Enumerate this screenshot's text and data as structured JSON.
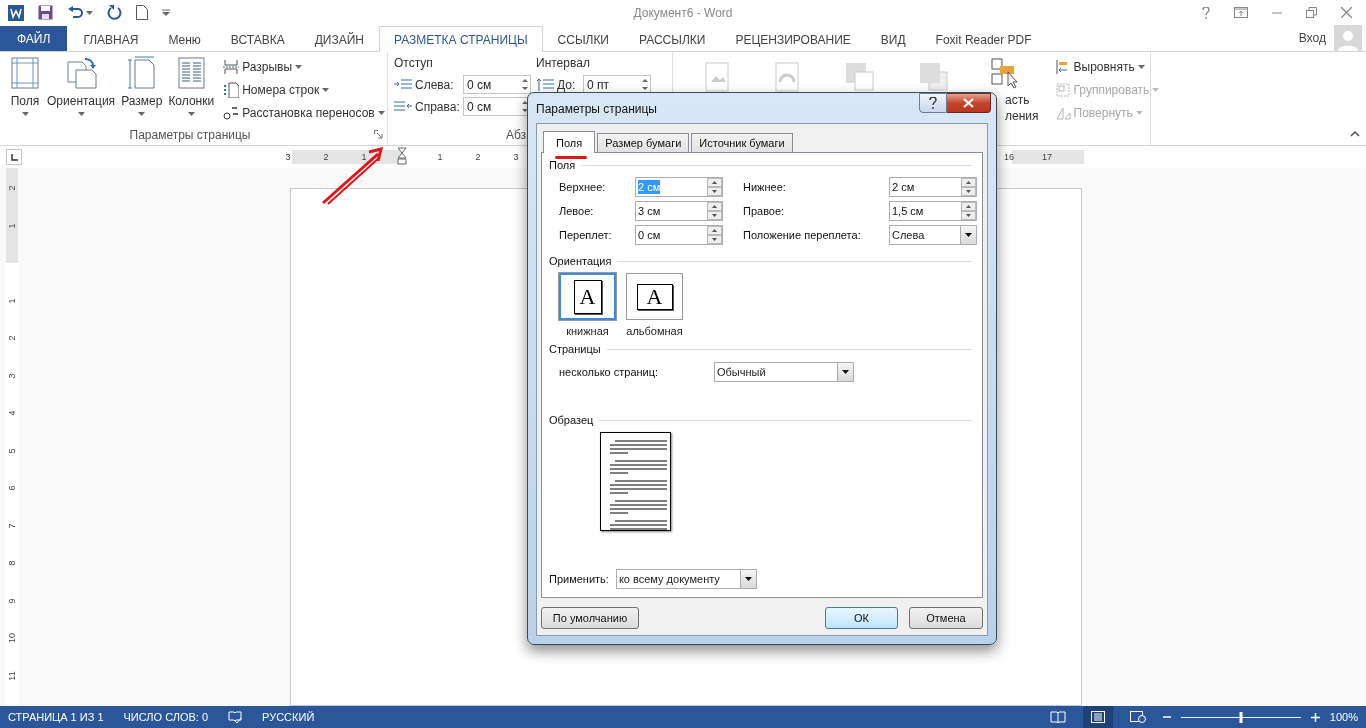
{
  "window": {
    "title": "Документ6 - Word",
    "sign_in": "Вход"
  },
  "tabs": [
    {
      "label": "ФАЙЛ",
      "kind": "file",
      "selected": false
    },
    {
      "label": "ГЛАВНАЯ",
      "kind": "tab",
      "selected": false
    },
    {
      "label": "Меню",
      "kind": "tab",
      "selected": false
    },
    {
      "label": "ВСТАВКА",
      "kind": "tab",
      "selected": false
    },
    {
      "label": "ДИЗАЙН",
      "kind": "tab",
      "selected": false
    },
    {
      "label": "РАЗМЕТКА СТРАНИЦЫ",
      "kind": "tab",
      "selected": true
    },
    {
      "label": "ССЫЛКИ",
      "kind": "tab",
      "selected": false
    },
    {
      "label": "РАССЫЛКИ",
      "kind": "tab",
      "selected": false
    },
    {
      "label": "РЕЦЕНЗИРОВАНИЕ",
      "kind": "tab",
      "selected": false
    },
    {
      "label": "ВИД",
      "kind": "tab",
      "selected": false
    },
    {
      "label": "Foxit Reader PDF",
      "kind": "tab",
      "selected": false
    }
  ],
  "page_setup_group": {
    "label": "Параметры страницы",
    "large_buttons": [
      {
        "label": "Поля",
        "kind": "margins"
      },
      {
        "label": "Ориентация",
        "kind": "orientation"
      },
      {
        "label": "Размер",
        "kind": "size"
      },
      {
        "label": "Колонки",
        "kind": "columns"
      }
    ],
    "small_buttons": [
      {
        "label": "Разрывы",
        "kind": "breaks"
      },
      {
        "label": "Номера строк",
        "kind": "line_numbers"
      },
      {
        "label": "Расстановка переносов",
        "kind": "hyphenation"
      }
    ]
  },
  "paragraph_group": {
    "label": "Абз",
    "indent": {
      "title": "Отступ",
      "fields": [
        {
          "label": "Слева:",
          "value": "0 см",
          "kind": "left"
        },
        {
          "label": "Справа:",
          "value": "0 см",
          "kind": "right"
        }
      ]
    },
    "spacing": {
      "title": "Интервал",
      "fields": [
        {
          "label": "До:",
          "value": "0 пт",
          "kind": "before"
        }
      ]
    }
  },
  "arrange_group": {
    "selection_pane": [
      "асть",
      "ления"
    ],
    "small_buttons": [
      {
        "label": "Выровнять",
        "kind": "align",
        "disabled": false
      },
      {
        "label": "Группировать",
        "kind": "group",
        "disabled": true
      },
      {
        "label": "Повернуть",
        "kind": "rotate",
        "disabled": true
      }
    ]
  },
  "ruler": {
    "before_origin": [
      "3",
      "2",
      "1"
    ],
    "after_origin": [
      "1",
      "2",
      "3"
    ],
    "right_edge": [
      "16",
      "17"
    ],
    "vertical_before": [
      "2",
      "1"
    ],
    "vertical_after": [
      "1",
      "2",
      "3",
      "4",
      "5",
      "6",
      "7",
      "8",
      "9",
      "10",
      "11"
    ]
  },
  "dialog": {
    "title": "Параметры страницы",
    "tabs": [
      {
        "label": "Поля",
        "selected": true
      },
      {
        "label": "Размер бумаги",
        "selected": false
      },
      {
        "label": "Источник бумаги",
        "selected": false
      }
    ],
    "margins": {
      "title": "Поля",
      "fields": [
        {
          "label": "Верхнее:",
          "value": "2 см",
          "kind": "spin",
          "highlighted": true
        },
        {
          "label": "Нижнее:",
          "value": "2 см",
          "kind": "spin",
          "highlighted": false
        },
        {
          "label": "Левое:",
          "value": "3 см",
          "kind": "spin",
          "highlighted": false
        },
        {
          "label": "Правое:",
          "value": "1,5 см",
          "kind": "spin",
          "highlighted": false
        },
        {
          "label": "Переплет:",
          "value": "0 см",
          "kind": "spin",
          "highlighted": false
        },
        {
          "label": "Положение переплета:",
          "value": "Слева",
          "kind": "dropdown"
        }
      ]
    },
    "orientation": {
      "title": "Ориентация",
      "options": [
        {
          "label": "книжная",
          "glyph": "A",
          "kind": "portrait",
          "selected": true
        },
        {
          "label": "альбомная",
          "glyph": "A",
          "kind": "landscape",
          "selected": false
        }
      ]
    },
    "pages": {
      "title": "Страницы",
      "label": "несколько страниц:",
      "value": "Обычный"
    },
    "preview": {
      "title": "Образец"
    },
    "apply": {
      "label": "Применить:",
      "value": "ко всему документу"
    },
    "buttons": [
      {
        "label": "По умолчанию",
        "kind": "default"
      },
      {
        "label": "ОК",
        "kind": "primary"
      },
      {
        "label": "Отмена",
        "kind": "cancel"
      }
    ]
  },
  "status_bar": {
    "page": "СТРАНИЦА 1 ИЗ 1",
    "words": "ЧИСЛО СЛОВ: 0",
    "language": "РУССКИЙ",
    "views": [
      {
        "kind": "read",
        "selected": false
      },
      {
        "kind": "print",
        "selected": true
      },
      {
        "kind": "web",
        "selected": false
      }
    ],
    "zoom": {
      "level": 0.5,
      "reading": "100%"
    }
  }
}
